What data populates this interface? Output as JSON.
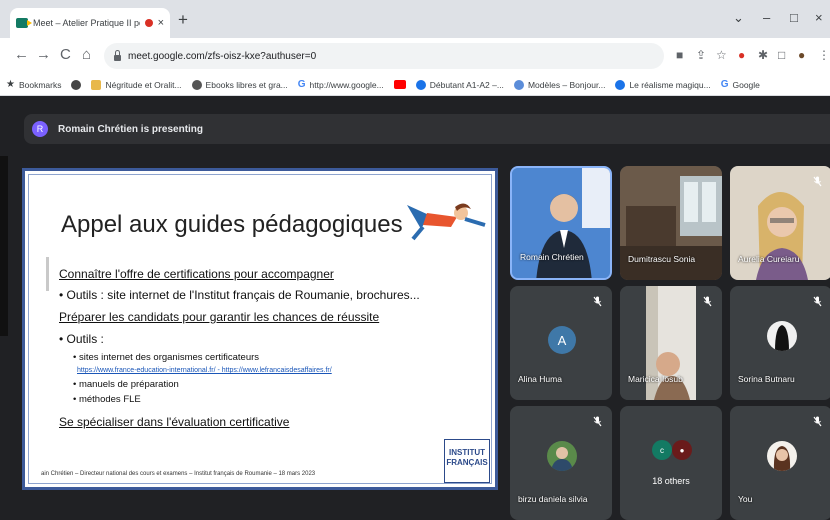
{
  "browser": {
    "tab_title": "Meet – Atelier Pratique II pe",
    "tab_close": "×",
    "new_tab": "+",
    "url": "meet.google.com/zfs-oisz-kxe?authuser=0",
    "nav": {
      "back": "←",
      "forward": "→",
      "reload": "C",
      "home": "⌂"
    },
    "window_controls": {
      "minimize": "–",
      "restore": "□",
      "close": "×",
      "dropdown": "⌄"
    },
    "bookmarks": [
      {
        "label": "Bookmarks",
        "icon": "star-icon",
        "color": "#3c4043"
      },
      {
        "label": "",
        "icon": "chromium-icon",
        "color": "#444444"
      },
      {
        "label": "Négritude et Oralit...",
        "icon": "book-icon",
        "color": "#e8b84a"
      },
      {
        "label": "Ebooks libres et gra...",
        "icon": "ebook-icon",
        "color": "#555555"
      },
      {
        "label": "http://www.google...",
        "icon": "google-icon",
        "color": "#4285f4"
      },
      {
        "label": "",
        "icon": "youtube-icon",
        "color": "#ff0000"
      },
      {
        "label": "Débutant A1-A2 –...",
        "icon": "site-icon",
        "color": "#1a73e8"
      },
      {
        "label": "Modèles – Bonjour...",
        "icon": "site-icon",
        "color": "#5b8dd9"
      },
      {
        "label": "Le réalisme magiqu...",
        "icon": "site-icon",
        "color": "#1a73e8"
      },
      {
        "label": "Google",
        "icon": "google-icon",
        "color": "#4285f4"
      }
    ]
  },
  "meet": {
    "presenter_initial": "R",
    "presenting_text": "Romain Chrétien is presenting",
    "slide": {
      "title": "Appel aux guides pédagogiques",
      "heading1": "Connaître l'offre de certifications pour accompagner",
      "bullet1": "• Outils : site internet de l'Institut français de Roumanie, brochures...",
      "heading2": "Préparer les candidats pour garantir les chances de réussite",
      "bullet2": "• Outils :",
      "sub1": "• sites internet des organismes certificateurs",
      "links": "https://www.france-education-international.fr/ - https://www.lefrancaisdesaffaires.fr/",
      "sub2": "• manuels de préparation",
      "sub3": "• méthodes FLE",
      "heading3": "Se spécialiser dans l'évaluation certificative",
      "footer": "ain Chrétien – Directeur national des cours et examens – Institut français de Roumanie – 18 mars 2023",
      "logo_line1": "INSTITUT",
      "logo_line2": "FRANÇAIS"
    },
    "participants": [
      {
        "name": "Romain Chrétien",
        "active": true,
        "muted": false
      },
      {
        "name": "Dumitrascu Sonia",
        "muted": false
      },
      {
        "name": "Aurelia Cureiaru",
        "muted": true
      },
      {
        "name": "Alina Huma",
        "initial": "A",
        "muted": true
      },
      {
        "name": "Maricica Iosub",
        "muted": true
      },
      {
        "name": "Sorina Butnaru",
        "muted": true
      },
      {
        "name": "birzu daniela silvia",
        "muted": true
      },
      {
        "name": "18 others",
        "mini_initial": "c"
      },
      {
        "name": "You",
        "muted": true
      }
    ],
    "colors": {
      "background": "#202124",
      "tile": "#3c4043",
      "active_border": "#8ab4f8",
      "avatar_blue": "#3f78a8"
    }
  }
}
